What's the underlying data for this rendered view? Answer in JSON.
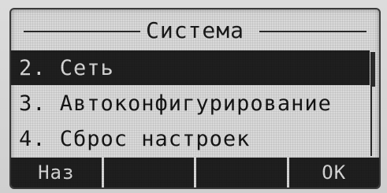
{
  "screen": {
    "title": "Система"
  },
  "menu": {
    "items": [
      {
        "label": "2. Сеть",
        "selected": true
      },
      {
        "label": "3. Автоконфигурирование",
        "selected": false
      },
      {
        "label": "4. Сброс настроек",
        "selected": false
      }
    ]
  },
  "softkeys": [
    {
      "label": "Наз"
    },
    {
      "label": ""
    },
    {
      "label": ""
    },
    {
      "label": "ОК"
    }
  ]
}
